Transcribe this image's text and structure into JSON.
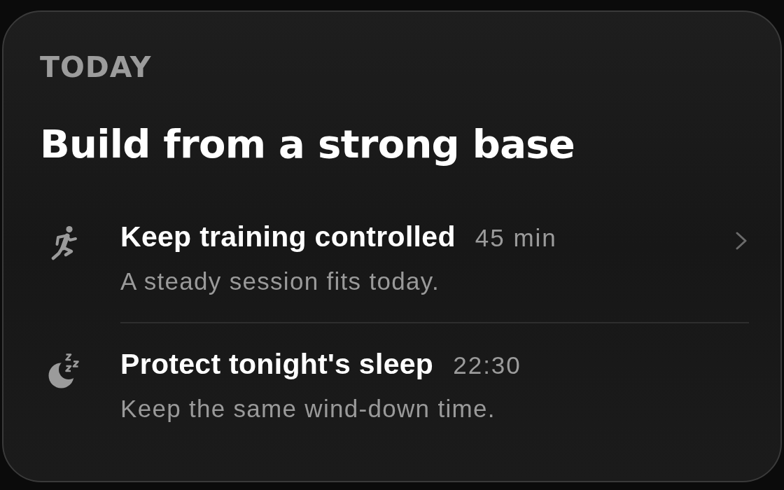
{
  "card": {
    "eyebrow": "TODAY",
    "title": "Build from a strong base",
    "items": [
      {
        "kind": "training",
        "title": "Keep training controlled",
        "meta": "45 min",
        "subtitle": "A steady session fits today.",
        "chevron": true
      },
      {
        "kind": "sleep",
        "title": "Protect tonight's sleep",
        "meta": "22:30",
        "subtitle": "Keep the same wind-down time.",
        "chevron": false
      }
    ]
  }
}
